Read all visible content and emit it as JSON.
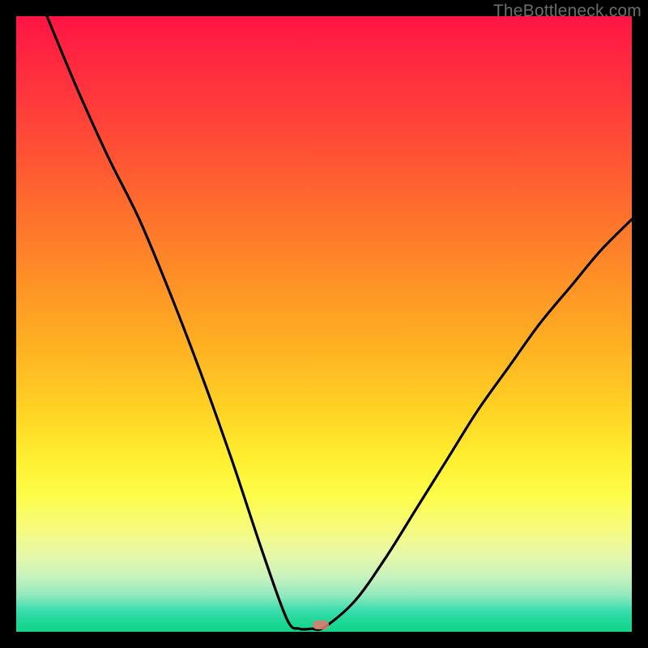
{
  "watermark": "TheBottleneck.com",
  "marker": {
    "x_pct": 49.5,
    "y_pct": 99
  },
  "chart_data": {
    "type": "line",
    "title": "",
    "xlabel": "",
    "ylabel": "",
    "xlim": [
      0,
      100
    ],
    "ylim": [
      0,
      100
    ],
    "background_gradient": [
      "#ff1445",
      "#ff8e27",
      "#fff030",
      "#13d48a"
    ],
    "series": [
      {
        "name": "bottleneck-curve",
        "x": [
          5,
          10,
          15,
          20,
          25,
          30,
          35,
          40,
          44,
          46,
          48,
          50,
          55,
          60,
          65,
          70,
          75,
          80,
          85,
          90,
          95,
          100
        ],
        "y": [
          100,
          88,
          77,
          67,
          55,
          42,
          28,
          13,
          2,
          0.5,
          0.5,
          0.7,
          5,
          12,
          20,
          28,
          36,
          43,
          50,
          56,
          62,
          67
        ]
      }
    ],
    "annotations": []
  }
}
